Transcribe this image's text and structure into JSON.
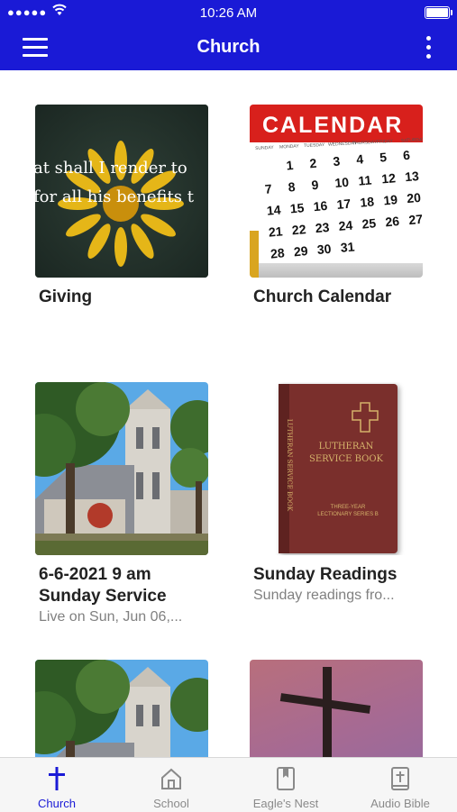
{
  "status_bar": {
    "time": "10:26 AM",
    "signal": "●●●●●"
  },
  "nav": {
    "title": "Church"
  },
  "cards": [
    {
      "title": "Giving",
      "subtitle": "",
      "image_text_line1": "at shall I render to",
      "image_text_line2": "for all his benefits t"
    },
    {
      "title": "Church Calendar",
      "subtitle": "",
      "calendar_header": "CALENDAR",
      "calendar_days": [
        "SUNDAY",
        "MONDAY",
        "TUESDAY",
        "WEDNESDAY",
        "THURSDAY",
        "FRIDAY",
        "SATURDAY"
      ],
      "calendar_numbers": [
        "1",
        "2",
        "3",
        "4",
        "5",
        "6",
        "7",
        "8",
        "9",
        "10",
        "11",
        "12",
        "13",
        "14",
        "15",
        "16",
        "17",
        "18",
        "19",
        "20",
        "21",
        "22",
        "23",
        "24",
        "25",
        "26",
        "27",
        "28",
        "29",
        "30",
        "31"
      ]
    },
    {
      "title": "6-6-2021 9 am Sunday Service",
      "title_line1": "6-6-2021 9 am",
      "title_line2": "Sunday Service",
      "subtitle": "Live on Sun, Jun 06,..."
    },
    {
      "title": "Sunday Readings",
      "subtitle": "Sunday readings fro...",
      "book_title_1": "LUTHERAN",
      "book_title_2": "SERVICE BOOK",
      "book_spine": "LUTHERAN SERVICE BOOK",
      "book_footer": "THREE-YEAR LECTIONARY SERIES B"
    },
    {
      "title": "",
      "subtitle": ""
    },
    {
      "title": "",
      "subtitle": ""
    }
  ],
  "tabs": [
    {
      "label": "Church",
      "icon": "cross-icon",
      "active": true
    },
    {
      "label": "School",
      "icon": "home-icon",
      "active": false
    },
    {
      "label": "Eagle's Nest",
      "icon": "bookmark-icon",
      "active": false
    },
    {
      "label": "Audio Bible",
      "icon": "bible-icon",
      "active": false
    }
  ],
  "colors": {
    "accent": "#1a1ad6",
    "tab_inactive": "#8a8a8a"
  }
}
